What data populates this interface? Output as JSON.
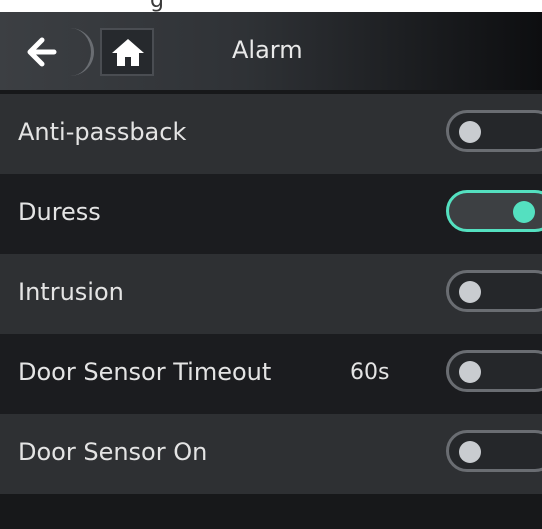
{
  "header": {
    "title": "Alarm",
    "back_icon": "arrow-left-icon",
    "home_icon": "home-icon",
    "partial_top_text": "g"
  },
  "settings": [
    {
      "label": "Anti-passback",
      "value": "",
      "enabled": false
    },
    {
      "label": "Duress",
      "value": "",
      "enabled": true
    },
    {
      "label": "Intrusion",
      "value": "",
      "enabled": false
    },
    {
      "label": "Door Sensor Timeout",
      "value": "60s",
      "enabled": false
    },
    {
      "label": "Door Sensor On",
      "value": "",
      "enabled": false
    }
  ],
  "colors": {
    "accent_on": "#54e0c0",
    "toggle_off_border": "#6a6d72",
    "row_light": "#2e3033",
    "row_dark": "#1b1c1f"
  }
}
